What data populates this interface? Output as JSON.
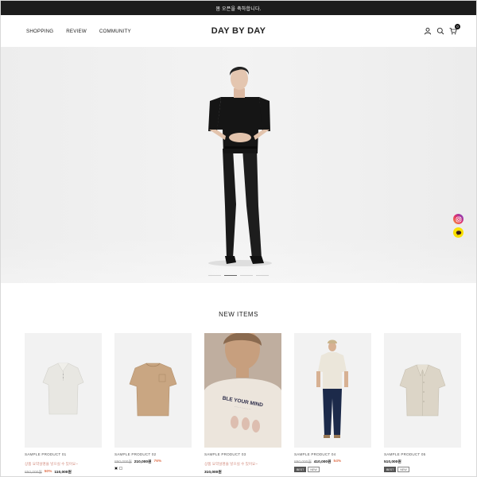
{
  "topbar": {
    "text": "봄 오픈을 축하합니다."
  },
  "header": {
    "logo": "DAY BY DAY",
    "nav": [
      "SHOPPING",
      "REVIEW",
      "COMMUNITY"
    ],
    "cart_count": "0"
  },
  "hero": {
    "slide_count": 4,
    "active_slide": 2
  },
  "new_items": {
    "title": "NEW ITEMS",
    "products": [
      {
        "name": "SAMPLE PRODUCT 01",
        "desc": "상품 요약설명을 넣으실 수 있어요~",
        "orig": "850,000원",
        "rate": "50%",
        "price": "110,000원",
        "tags": []
      },
      {
        "name": "SAMPLE PRODUCT 02",
        "desc": "",
        "orig": "890,000원",
        "rate": "76%",
        "price": "210,000원",
        "tags": []
      },
      {
        "name": "SAMPLE PRODUCT 03",
        "desc": "상품 요약설명을 넣으실 수 있어요~",
        "orig": "",
        "rate": "",
        "price": "310,000원",
        "tags": []
      },
      {
        "name": "SAMPLE PRODUCT 04",
        "desc": "",
        "orig": "890,000원",
        "rate": "54%",
        "price": "410,000원",
        "tags": [
          "BEST",
          "NEW"
        ]
      },
      {
        "name": "SAMPLE PRODUCT 05",
        "desc": "",
        "orig": "",
        "rate": "",
        "price": "510,000원",
        "tags": [
          "BEST",
          "NEW"
        ]
      }
    ]
  },
  "colors": {
    "topbar_bg": "#1c1c1c",
    "sale_rate": "#e0734f",
    "instagram": "#e1306c",
    "kakao": "#f9e000"
  }
}
